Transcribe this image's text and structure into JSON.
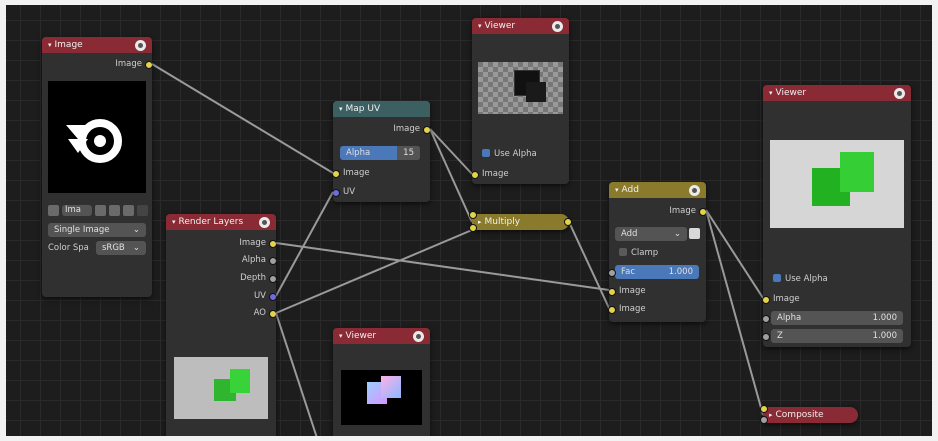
{
  "nodes": {
    "image": {
      "title": "Image",
      "output": "Image",
      "name_field": "Ima",
      "source": "Single Image",
      "color_space_label": "Color Spa",
      "color_space_value": "sRGB"
    },
    "mapuv": {
      "title": "Map UV",
      "output": "Image",
      "alpha_label": "Alpha",
      "alpha_value": "15",
      "in_image": "Image",
      "in_uv": "UV"
    },
    "viewer_top": {
      "title": "Viewer",
      "use_alpha": "Use Alpha",
      "in_image": "Image"
    },
    "multiply": {
      "title": "Multiply"
    },
    "render_layers": {
      "title": "Render Layers",
      "outputs": [
        "Image",
        "Alpha",
        "Depth",
        "UV",
        "AO"
      ]
    },
    "add": {
      "title": "Add",
      "output": "Image",
      "blend": "Add",
      "clamp": "Clamp",
      "fac_label": "Fac",
      "fac_value": "1.000",
      "in_image1": "Image",
      "in_image2": "Image"
    },
    "viewer_right": {
      "title": "Viewer",
      "use_alpha": "Use Alpha",
      "in_image": "Image",
      "alpha_label": "Alpha",
      "alpha_value": "1.000",
      "z_label": "Z",
      "z_value": "1.000"
    },
    "viewer_bottom": {
      "title": "Viewer"
    },
    "composite": {
      "title": "Composite"
    }
  },
  "icons": [
    "chevron-down-icon",
    "node-menu-icon",
    "blender-logo-icon",
    "checkbox-icon"
  ],
  "colors": {
    "input_header": "#8a2a35",
    "vector_header": "#3c6062",
    "color_header": "#8a7a2c",
    "link": "#9a9a9a",
    "socket_color": "#e3d34a",
    "socket_gray": "#a0a0a0",
    "socket_vector": "#6c6ce0",
    "field_active": "#4a78b8"
  }
}
